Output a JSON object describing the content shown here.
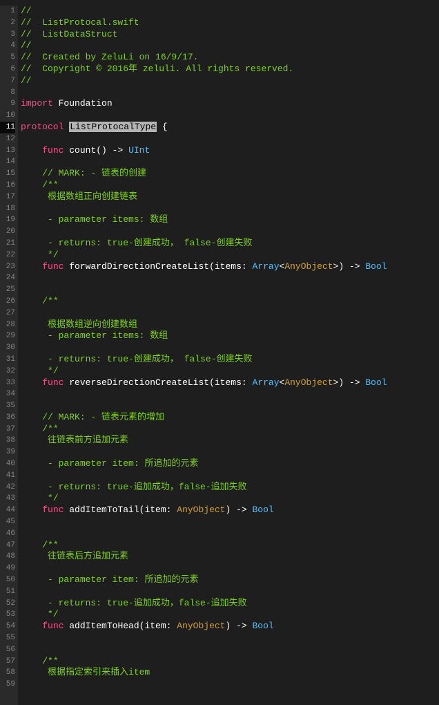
{
  "lineCount": 59,
  "activeLine": 11,
  "lines": [
    {
      "n": 1,
      "tokens": [
        {
          "c": "comment",
          "t": "//"
        }
      ]
    },
    {
      "n": 2,
      "tokens": [
        {
          "c": "comment",
          "t": "//  ListProtocal.swift"
        }
      ]
    },
    {
      "n": 3,
      "tokens": [
        {
          "c": "comment",
          "t": "//  ListDataStruct"
        }
      ]
    },
    {
      "n": 4,
      "tokens": [
        {
          "c": "comment",
          "t": "//"
        }
      ]
    },
    {
      "n": 5,
      "tokens": [
        {
          "c": "comment",
          "t": "//  Created by ZeluLi on 16/9/17."
        }
      ]
    },
    {
      "n": 6,
      "tokens": [
        {
          "c": "comment",
          "t": "//  Copyright © 2016年 zeluli. All rights reserved."
        }
      ]
    },
    {
      "n": 7,
      "tokens": [
        {
          "c": "comment",
          "t": "//"
        }
      ]
    },
    {
      "n": 8,
      "tokens": []
    },
    {
      "n": 9,
      "tokens": [
        {
          "c": "keyword",
          "t": "import"
        },
        {
          "c": "plain",
          "t": " Foundation"
        }
      ]
    },
    {
      "n": 10,
      "tokens": []
    },
    {
      "n": 11,
      "tokens": [
        {
          "c": "keyword",
          "t": "protocol"
        },
        {
          "c": "plain",
          "t": " "
        },
        {
          "c": "highlight",
          "t": "ListProtocalType"
        },
        {
          "c": "plain",
          "t": " {"
        }
      ]
    },
    {
      "n": 12,
      "tokens": []
    },
    {
      "n": 13,
      "tokens": [
        {
          "c": "plain",
          "t": "    "
        },
        {
          "c": "keyword",
          "t": "func"
        },
        {
          "c": "plain",
          "t": " count() -> "
        },
        {
          "c": "type",
          "t": "UInt"
        }
      ]
    },
    {
      "n": 14,
      "tokens": []
    },
    {
      "n": 15,
      "tokens": [
        {
          "c": "plain",
          "t": "    "
        },
        {
          "c": "comment",
          "t": "// MARK: - 链表的创建"
        }
      ]
    },
    {
      "n": 16,
      "tokens": [
        {
          "c": "plain",
          "t": "    "
        },
        {
          "c": "comment",
          "t": "/**"
        }
      ]
    },
    {
      "n": 17,
      "tokens": [
        {
          "c": "plain",
          "t": "     "
        },
        {
          "c": "comment",
          "t": "根据数组正向创建链表"
        }
      ]
    },
    {
      "n": 18,
      "tokens": [
        {
          "c": "plain",
          "t": "     "
        }
      ]
    },
    {
      "n": 19,
      "tokens": [
        {
          "c": "plain",
          "t": "     "
        },
        {
          "c": "comment",
          "t": "- parameter items: 数组"
        }
      ]
    },
    {
      "n": 20,
      "tokens": [
        {
          "c": "plain",
          "t": "     "
        }
      ]
    },
    {
      "n": 21,
      "tokens": [
        {
          "c": "plain",
          "t": "     "
        },
        {
          "c": "comment",
          "t": "- returns: true-创建成功， false-创建失败"
        }
      ]
    },
    {
      "n": 22,
      "tokens": [
        {
          "c": "plain",
          "t": "     "
        },
        {
          "c": "comment",
          "t": "*/"
        }
      ]
    },
    {
      "n": 23,
      "tokens": [
        {
          "c": "plain",
          "t": "    "
        },
        {
          "c": "keyword",
          "t": "func"
        },
        {
          "c": "plain",
          "t": " forwardDirectionCreateList(items: "
        },
        {
          "c": "type",
          "t": "Array"
        },
        {
          "c": "plain",
          "t": "<"
        },
        {
          "c": "type2",
          "t": "AnyObject"
        },
        {
          "c": "plain",
          "t": ">) -> "
        },
        {
          "c": "type",
          "t": "Bool"
        }
      ]
    },
    {
      "n": 24,
      "tokens": []
    },
    {
      "n": 25,
      "tokens": []
    },
    {
      "n": 26,
      "tokens": [
        {
          "c": "plain",
          "t": "    "
        },
        {
          "c": "comment",
          "t": "/**"
        }
      ]
    },
    {
      "n": 27,
      "tokens": []
    },
    {
      "n": 28,
      "tokens": [
        {
          "c": "plain",
          "t": "     "
        },
        {
          "c": "comment",
          "t": "根据数组逆向创建数组"
        }
      ]
    },
    {
      "n": 29,
      "tokens": [
        {
          "c": "plain",
          "t": "     "
        },
        {
          "c": "comment",
          "t": "- parameter items: 数组"
        }
      ]
    },
    {
      "n": 30,
      "tokens": []
    },
    {
      "n": 31,
      "tokens": [
        {
          "c": "plain",
          "t": "     "
        },
        {
          "c": "comment",
          "t": "- returns: true-创建成功， false-创建失败"
        }
      ]
    },
    {
      "n": 32,
      "tokens": [
        {
          "c": "plain",
          "t": "     "
        },
        {
          "c": "comment",
          "t": "*/"
        }
      ]
    },
    {
      "n": 33,
      "tokens": [
        {
          "c": "plain",
          "t": "    "
        },
        {
          "c": "keyword",
          "t": "func"
        },
        {
          "c": "plain",
          "t": " reverseDirectionCreateList(items: "
        },
        {
          "c": "type",
          "t": "Array"
        },
        {
          "c": "plain",
          "t": "<"
        },
        {
          "c": "type2",
          "t": "AnyObject"
        },
        {
          "c": "plain",
          "t": ">) -> "
        },
        {
          "c": "type",
          "t": "Bool"
        }
      ]
    },
    {
      "n": 34,
      "tokens": []
    },
    {
      "n": 35,
      "tokens": []
    },
    {
      "n": 36,
      "tokens": [
        {
          "c": "plain",
          "t": "    "
        },
        {
          "c": "comment",
          "t": "// MARK: - 链表元素的增加"
        }
      ]
    },
    {
      "n": 37,
      "tokens": [
        {
          "c": "plain",
          "t": "    "
        },
        {
          "c": "comment",
          "t": "/**"
        }
      ]
    },
    {
      "n": 38,
      "tokens": [
        {
          "c": "plain",
          "t": "     "
        },
        {
          "c": "comment",
          "t": "往链表前方追加元素"
        }
      ]
    },
    {
      "n": 39,
      "tokens": [
        {
          "c": "plain",
          "t": "     "
        }
      ]
    },
    {
      "n": 40,
      "tokens": [
        {
          "c": "plain",
          "t": "     "
        },
        {
          "c": "comment",
          "t": "- parameter item: 所追加的元素"
        }
      ]
    },
    {
      "n": 41,
      "tokens": [
        {
          "c": "plain",
          "t": "     "
        }
      ]
    },
    {
      "n": 42,
      "tokens": [
        {
          "c": "plain",
          "t": "     "
        },
        {
          "c": "comment",
          "t": "- returns: true-追加成功，false-追加失败"
        }
      ]
    },
    {
      "n": 43,
      "tokens": [
        {
          "c": "plain",
          "t": "     "
        },
        {
          "c": "comment",
          "t": "*/"
        }
      ]
    },
    {
      "n": 44,
      "tokens": [
        {
          "c": "plain",
          "t": "    "
        },
        {
          "c": "keyword",
          "t": "func"
        },
        {
          "c": "plain",
          "t": " addItemToTail(item: "
        },
        {
          "c": "type2",
          "t": "AnyObject"
        },
        {
          "c": "plain",
          "t": ") -> "
        },
        {
          "c": "type",
          "t": "Bool"
        }
      ]
    },
    {
      "n": 45,
      "tokens": []
    },
    {
      "n": 46,
      "tokens": []
    },
    {
      "n": 47,
      "tokens": [
        {
          "c": "plain",
          "t": "    "
        },
        {
          "c": "comment",
          "t": "/**"
        }
      ]
    },
    {
      "n": 48,
      "tokens": [
        {
          "c": "plain",
          "t": "     "
        },
        {
          "c": "comment",
          "t": "往链表后方追加元素"
        }
      ]
    },
    {
      "n": 49,
      "tokens": [
        {
          "c": "plain",
          "t": "     "
        }
      ]
    },
    {
      "n": 50,
      "tokens": [
        {
          "c": "plain",
          "t": "     "
        },
        {
          "c": "comment",
          "t": "- parameter item: 所追加的元素"
        }
      ]
    },
    {
      "n": 51,
      "tokens": [
        {
          "c": "plain",
          "t": "     "
        }
      ]
    },
    {
      "n": 52,
      "tokens": [
        {
          "c": "plain",
          "t": "     "
        },
        {
          "c": "comment",
          "t": "- returns: true-追加成功，false-追加失败"
        }
      ]
    },
    {
      "n": 53,
      "tokens": [
        {
          "c": "plain",
          "t": "     "
        },
        {
          "c": "comment",
          "t": "*/"
        }
      ]
    },
    {
      "n": 54,
      "tokens": [
        {
          "c": "plain",
          "t": "    "
        },
        {
          "c": "keyword",
          "t": "func"
        },
        {
          "c": "plain",
          "t": " addItemToHead(item: "
        },
        {
          "c": "type2",
          "t": "AnyObject"
        },
        {
          "c": "plain",
          "t": ") -> "
        },
        {
          "c": "type",
          "t": "Bool"
        }
      ]
    },
    {
      "n": 55,
      "tokens": []
    },
    {
      "n": 56,
      "tokens": []
    },
    {
      "n": 57,
      "tokens": [
        {
          "c": "plain",
          "t": "    "
        },
        {
          "c": "comment",
          "t": "/**"
        }
      ]
    },
    {
      "n": 58,
      "tokens": [
        {
          "c": "plain",
          "t": "     "
        },
        {
          "c": "comment",
          "t": "根据指定索引来插入item"
        }
      ]
    },
    {
      "n": 59,
      "tokens": []
    }
  ]
}
